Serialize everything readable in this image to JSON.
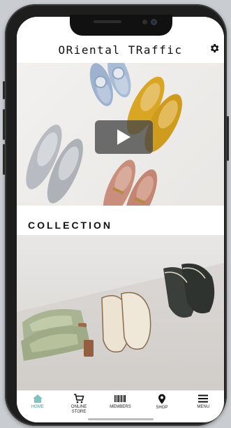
{
  "header": {
    "logo_text": "ORiental TRaffic",
    "settings_icon": "gear-icon"
  },
  "hero": {
    "media": "video-thumbnail",
    "play_icon": "play-icon"
  },
  "collection": {
    "title": "COLLECTION"
  },
  "tabbar": {
    "items": [
      {
        "label": "HOME",
        "icon": "home-icon",
        "active": true
      },
      {
        "label": "ONLINE\nSTORE",
        "icon": "cart-icon",
        "active": false
      },
      {
        "label": "MEMBERS",
        "icon": "barcode-icon",
        "active": false
      },
      {
        "label": "SHOP",
        "icon": "location-pin-icon",
        "active": false
      },
      {
        "label": "MENU",
        "icon": "menu-icon",
        "active": false
      }
    ]
  },
  "colors": {
    "accent": "#4a9a97",
    "phone_frame": "#1e1e1e",
    "background": "#ffffff"
  }
}
